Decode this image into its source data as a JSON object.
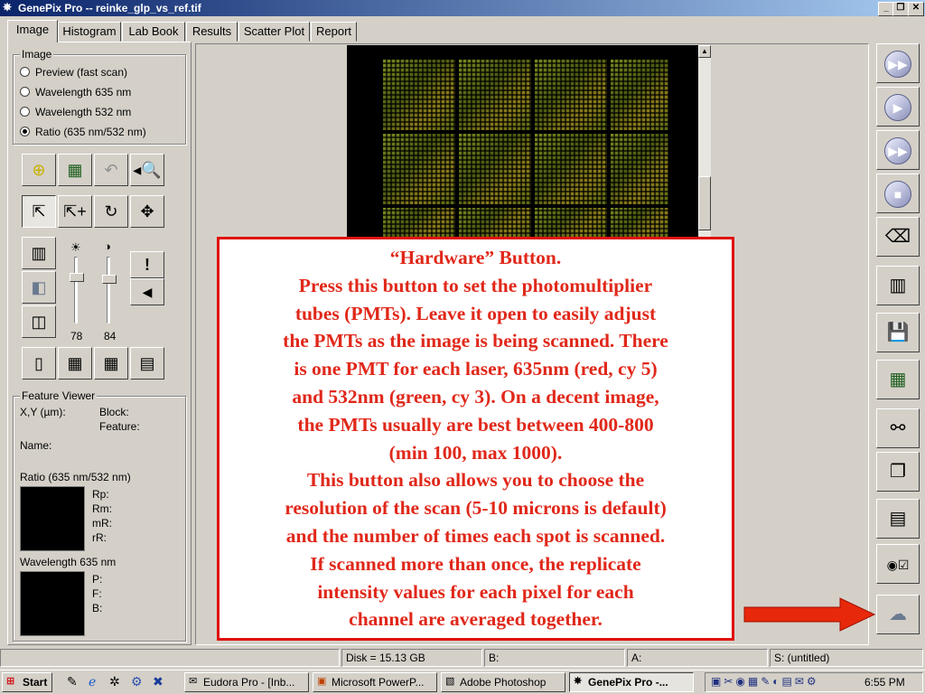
{
  "window": {
    "title": "GenePix Pro -- reinke_glp_vs_ref.tif",
    "minimize_label": "_",
    "restore_label": "❐",
    "close_label": "✕"
  },
  "tabs": [
    {
      "label": "Image",
      "active": true
    },
    {
      "label": "Histogram"
    },
    {
      "label": "Lab Book"
    },
    {
      "label": "Results"
    },
    {
      "label": "Scatter Plot"
    },
    {
      "label": "Report"
    }
  ],
  "image_group": {
    "label": "Image",
    "options": [
      {
        "label": "Preview  (fast scan)",
        "selected": false
      },
      {
        "label": "Wavelength 635 nm",
        "selected": false
      },
      {
        "label": "Wavelength 532 nm",
        "selected": false
      },
      {
        "label": "Ratio (635 nm/532 nm)",
        "selected": true
      }
    ]
  },
  "sliders": {
    "brightness_value": "78",
    "contrast_value": "84",
    "brightness_level": 0.72,
    "contrast_level": 0.68
  },
  "feature_viewer": {
    "label": "Feature Viewer",
    "xy_label": "X,Y (µm):",
    "block_label": "Block:",
    "feature_label": "Feature:",
    "name_label": "Name:",
    "ratio_label": "Ratio (635 nm/532 nm)",
    "ratio_fields": [
      "Rp:",
      "Rm:",
      "mR:",
      "rR:"
    ],
    "wavelength_label": "Wavelength 635 nm",
    "wavelength_fields": [
      "P:",
      "F:",
      "B:"
    ]
  },
  "callout": {
    "lines": [
      "“Hardware” Button.",
      "Press this button to set the photomultiplier",
      "tubes (PMTs).  Leave it open to easily adjust",
      "the PMTs as the image is being scanned. There",
      "is one PMT for each laser, 635nm (red, cy 5)",
      "and 532nm (green, cy 3).  On a decent image,",
      "the PMTs usually are best between 400-800",
      "(min 100, max 1000).",
      "This button also allows you to choose the",
      "resolution of the scan (5-10 microns is default)",
      "and the number of times each spot is scanned.",
      "If scanned more than once, the replicate",
      "intensity values for each pixel for each",
      "channel are averaged together."
    ]
  },
  "status_bar": {
    "disk": "Disk = 15.13 GB",
    "b": "B:",
    "a": "A:",
    "s": "S: (untitled)"
  },
  "taskbar": {
    "start_label": "Start",
    "tasks": [
      {
        "label": "Eudora Pro - [Inb...",
        "active": false
      },
      {
        "label": "Microsoft PowerP...",
        "active": false
      },
      {
        "label": "Adobe Photoshop",
        "active": false
      },
      {
        "label": "GenePix Pro -...",
        "active": true
      }
    ],
    "clock": "6:55 PM"
  },
  "colors": {
    "callout_red": "#e0281a",
    "arrow_red": "#e8280a",
    "titlebar_start": "#0a246a"
  }
}
